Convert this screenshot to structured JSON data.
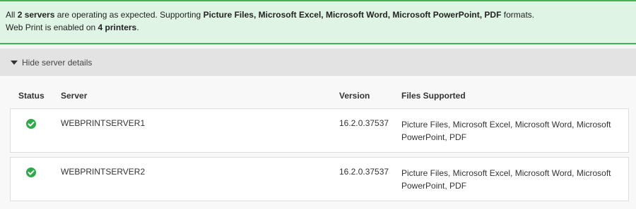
{
  "banner": {
    "line1_prefix": "All",
    "servers_count": "2 servers",
    "line1_mid": "are operating as expected. Supporting",
    "formats": "Picture Files, Microsoft Excel, Microsoft Word, Microsoft PowerPoint, PDF",
    "line1_suffix": "formats.",
    "line2_prefix": "Web Print is enabled on",
    "printers_count": "4 printers",
    "line2_suffix": "."
  },
  "details_toggle": {
    "label": "Hide server details"
  },
  "table": {
    "headers": {
      "status": "Status",
      "server": "Server",
      "version": "Version",
      "files": "Files Supported"
    },
    "rows": [
      {
        "server": "WEBPRINTSERVER1",
        "version": "16.2.0.37537",
        "files": "Picture Files, Microsoft Excel, Microsoft Word, Microsoft PowerPoint, PDF",
        "status_icon": "check-circle-icon"
      },
      {
        "server": "WEBPRINTSERVER2",
        "version": "16.2.0.37537",
        "files": "Picture Files, Microsoft Excel, Microsoft Word, Microsoft PowerPoint, PDF",
        "status_icon": "check-circle-icon"
      }
    ]
  },
  "colors": {
    "success": "#2eaa4a",
    "banner_bg": "#dff4e4",
    "banner_border": "#3fb25a"
  }
}
